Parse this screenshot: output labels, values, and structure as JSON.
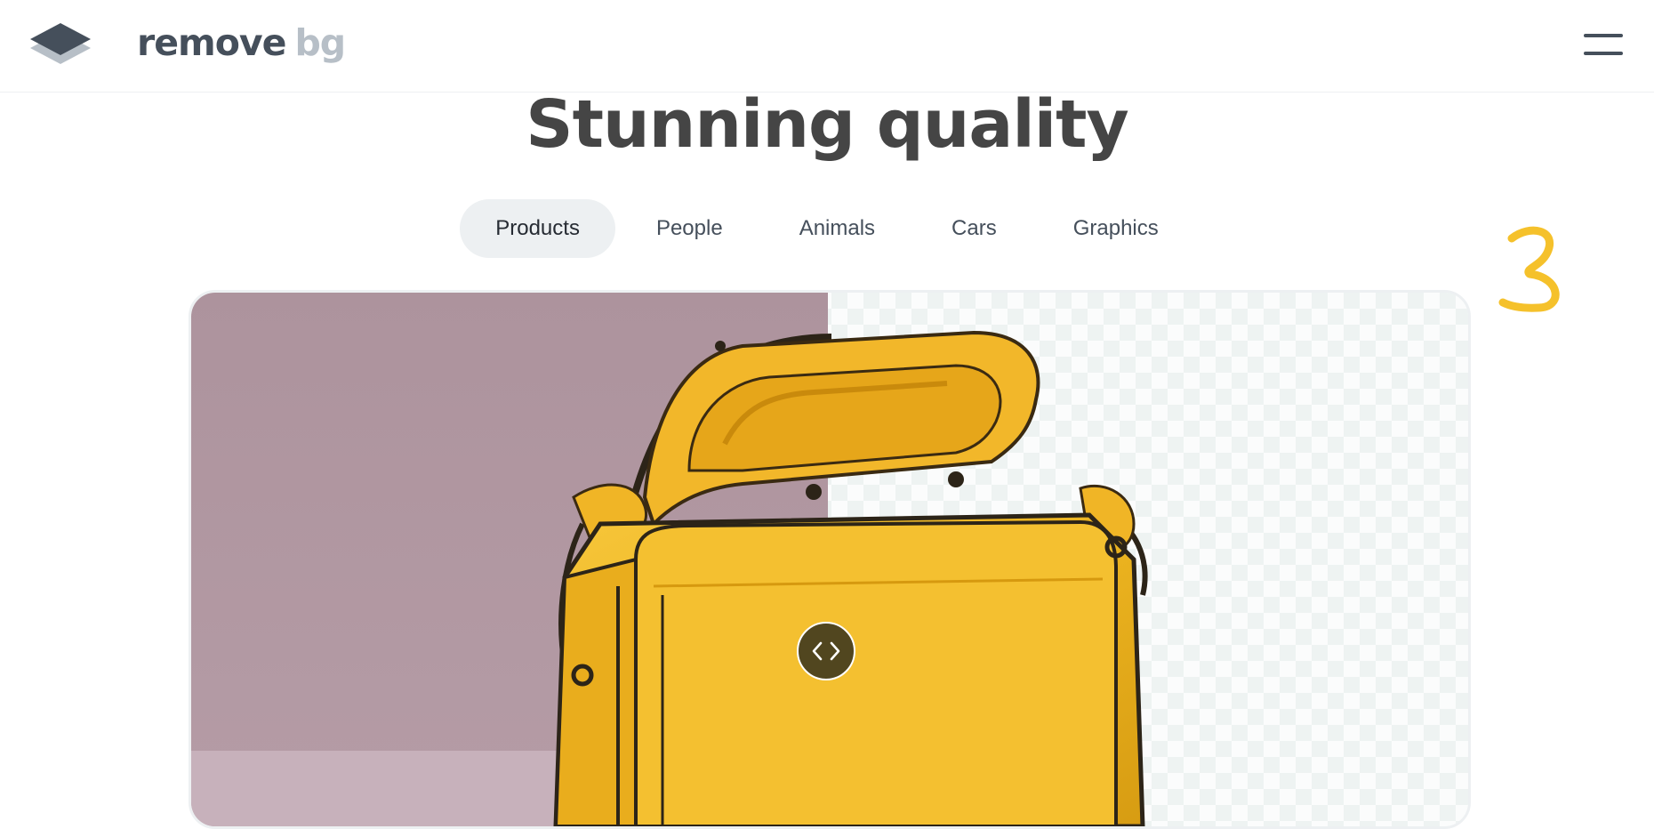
{
  "header": {
    "logo_word_primary": "remove",
    "logo_word_secondary": "bg",
    "menu_icon": "hamburger-icon"
  },
  "hero": {
    "title": "Stunning quality"
  },
  "tabs": [
    {
      "label": "Products",
      "active": true
    },
    {
      "label": "People",
      "active": false
    },
    {
      "label": "Animals",
      "active": false
    },
    {
      "label": "Cars",
      "active": false
    },
    {
      "label": "Graphics",
      "active": false
    }
  ],
  "comparison": {
    "subject": "yellow leather handbag",
    "before_background": "mauve studio backdrop",
    "after_background": "transparent checkerboard",
    "handle_icon": "chevrons-left-right-icon"
  },
  "colors": {
    "brand_text": "#454f5b",
    "brand_muted": "#b7bfc7",
    "title": "#454545",
    "tab_active_bg": "#edf0f2",
    "accent_yellow": "#f5c12b",
    "backdrop": "#ad939d"
  }
}
